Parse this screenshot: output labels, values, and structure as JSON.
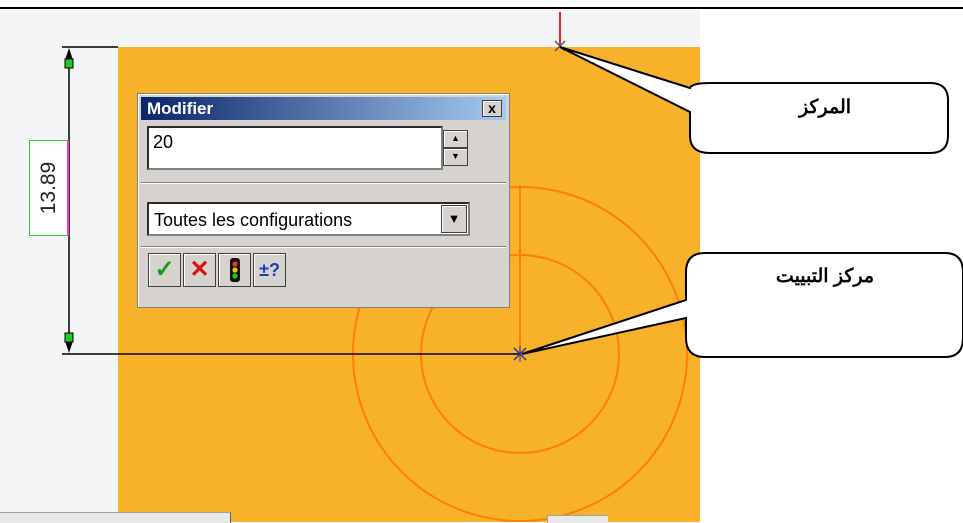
{
  "dimension": {
    "value_text": "13.89"
  },
  "modify_dialog": {
    "title": "Modifier",
    "close_glyph": "x",
    "value": "20",
    "configuration": "Toutes les configurations",
    "buttons": {
      "ok_glyph": "✓",
      "cancel_glyph": "✕",
      "rebuild_icon": "traffic-light-icon",
      "tolerance_label": "±?"
    }
  },
  "callouts": {
    "center": "المركز",
    "fix_center": "مركز التبييت"
  },
  "colors": {
    "sketch_face": "#f7b12a",
    "sketch_lines": "#ff7f00",
    "title_gradient_start": "#0a246a"
  }
}
